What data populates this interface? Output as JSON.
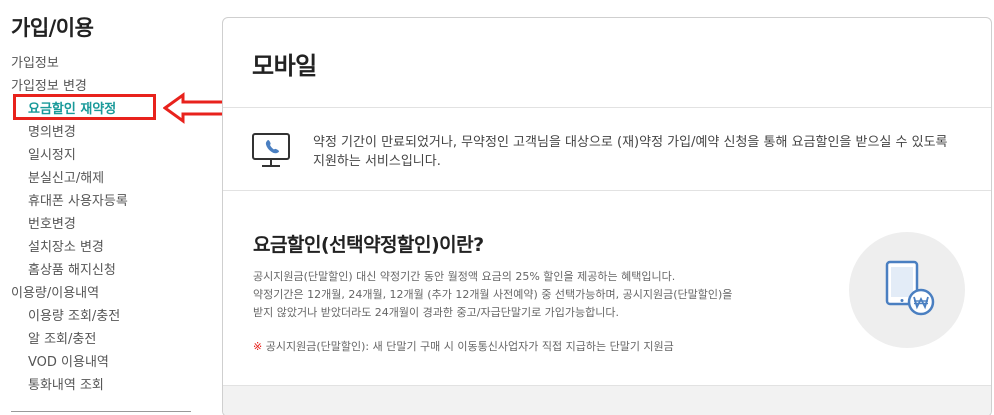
{
  "sidebar": {
    "title": "가입/이용",
    "items": [
      {
        "label": "가입정보",
        "level": 1
      },
      {
        "label": "가입정보 변경",
        "level": 1
      },
      {
        "label": "요금할인 재약정",
        "level": 2,
        "active": true
      },
      {
        "label": "명의변경",
        "level": 2
      },
      {
        "label": "일시정지",
        "level": 2
      },
      {
        "label": "분실신고/해제",
        "level": 2
      },
      {
        "label": "휴대폰 사용자등록",
        "level": 2
      },
      {
        "label": "번호변경",
        "level": 2
      },
      {
        "label": "설치장소 변경",
        "level": 2
      },
      {
        "label": "홈상품 해지신청",
        "level": 2
      },
      {
        "label": "이용량/이용내역",
        "level": 1
      },
      {
        "label": "이용량 조회/충전",
        "level": 2
      },
      {
        "label": "알 조회/충전",
        "level": 2
      },
      {
        "label": "VOD 이용내역",
        "level": 2
      },
      {
        "label": "통화내역 조회",
        "level": 2
      }
    ],
    "annotation_icon": "left-arrow-icon"
  },
  "main": {
    "title": "모바일",
    "info": {
      "icon": "monitor-phone-icon",
      "text": "약정 기간이 만료되었거나, 무약정인 고객님을 대상으로 (재)약정 가입/예약 신청을 통해 요금할인을 받으실 수 있도록 지원하는 서비스입니다."
    },
    "section": {
      "title": "요금할인(선택약정할인)이란?",
      "lines": [
        "공시지원금(단말할인) 대신 약정기간 동안 월정액 요금의 25% 할인을 제공하는 혜택입니다.",
        "약정기간은 12개월, 24개월, 12개월 (추가 12개월 사전예약) 중 선택가능하며, 공시지원금(단말할인)을",
        "받지 않았거나 받았더라도 24개월이 경과한 중고/자급단말기로 가입가능합니다."
      ],
      "note_mark": "※",
      "note": "공시지원금(단말할인): 새 단말기 구매 시 이동통신사업자가 직접 지급하는 단말기 지원금",
      "illustration_icon": "tablet-won-icon"
    }
  },
  "colors": {
    "accent": "#1a9a9a",
    "highlight_red": "#e8221c",
    "icon_blue": "#4a7fc1"
  }
}
